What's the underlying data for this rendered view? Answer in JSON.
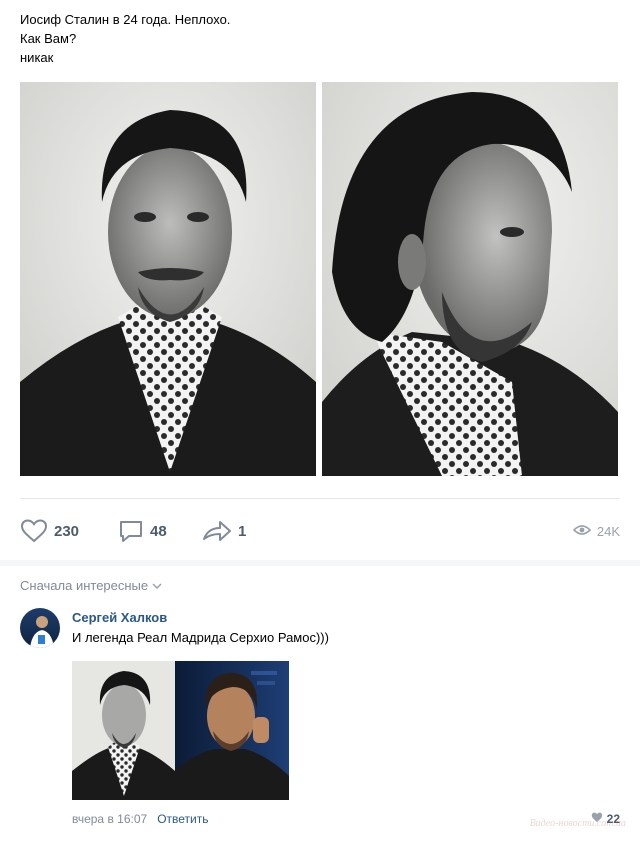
{
  "post": {
    "lines": [
      "Иосиф Сталин в 24 года. Неплохо.",
      "Как Вам?",
      "никак"
    ],
    "photos": [
      "stalin-portrait-front",
      "stalin-portrait-profile"
    ]
  },
  "actions": {
    "likes": "230",
    "comments": "48",
    "shares": "1",
    "views": "24K"
  },
  "comments_section": {
    "sort_label": "Сначала интересные",
    "comment": {
      "author": "Сергей Халков",
      "text": "И легенда Реал Мадрида Серхио Рамос)))",
      "time": "вчера в 16:07",
      "reply_label": "Ответить",
      "likes": "22"
    }
  },
  "watermark": "Видео-новости.com.ua",
  "colors": {
    "link": "#2a5885",
    "icon": "#828a99",
    "count": "#4d5b6b",
    "divider": "#e7e8ec"
  }
}
